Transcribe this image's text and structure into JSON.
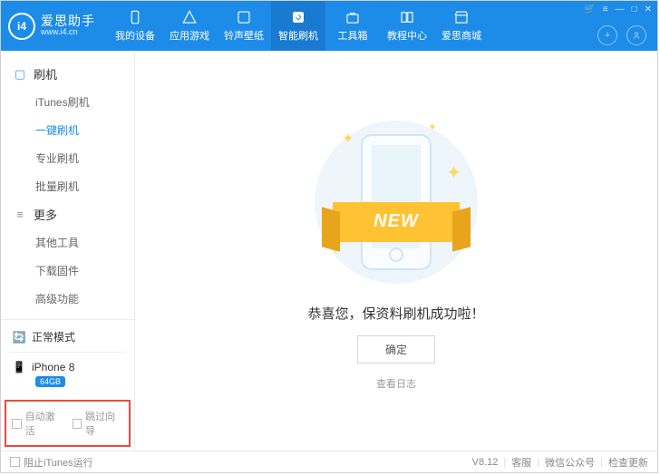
{
  "brand": {
    "name": "爱思助手",
    "site": "www.i4.cn",
    "logo_letters": "i4"
  },
  "nav": {
    "items": [
      {
        "label": "我的设备"
      },
      {
        "label": "应用游戏"
      },
      {
        "label": "铃声壁纸"
      },
      {
        "label": "智能刷机"
      },
      {
        "label": "工具箱"
      },
      {
        "label": "教程中心"
      },
      {
        "label": "爱思商城"
      }
    ]
  },
  "sidebar": {
    "section1": {
      "title": "刷机",
      "items": [
        "iTunes刷机",
        "一键刷机",
        "专业刷机",
        "批量刷机"
      ]
    },
    "section2": {
      "title": "更多",
      "items": [
        "其他工具",
        "下载固件",
        "高级功能"
      ]
    },
    "status": {
      "mode": "正常模式",
      "device": "iPhone 8",
      "storage": "64GB"
    },
    "bottom": {
      "auto_activate": "自动激活",
      "skip_guide": "跳过向导"
    }
  },
  "main": {
    "ribbon": "NEW",
    "message": "恭喜您，保资料刷机成功啦！",
    "ok": "确定",
    "view_log": "查看日志"
  },
  "footer": {
    "block_itunes": "阻止iTunes运行",
    "version": "V8.12",
    "support": "客服",
    "wechat": "微信公众号",
    "update": "检查更新"
  }
}
